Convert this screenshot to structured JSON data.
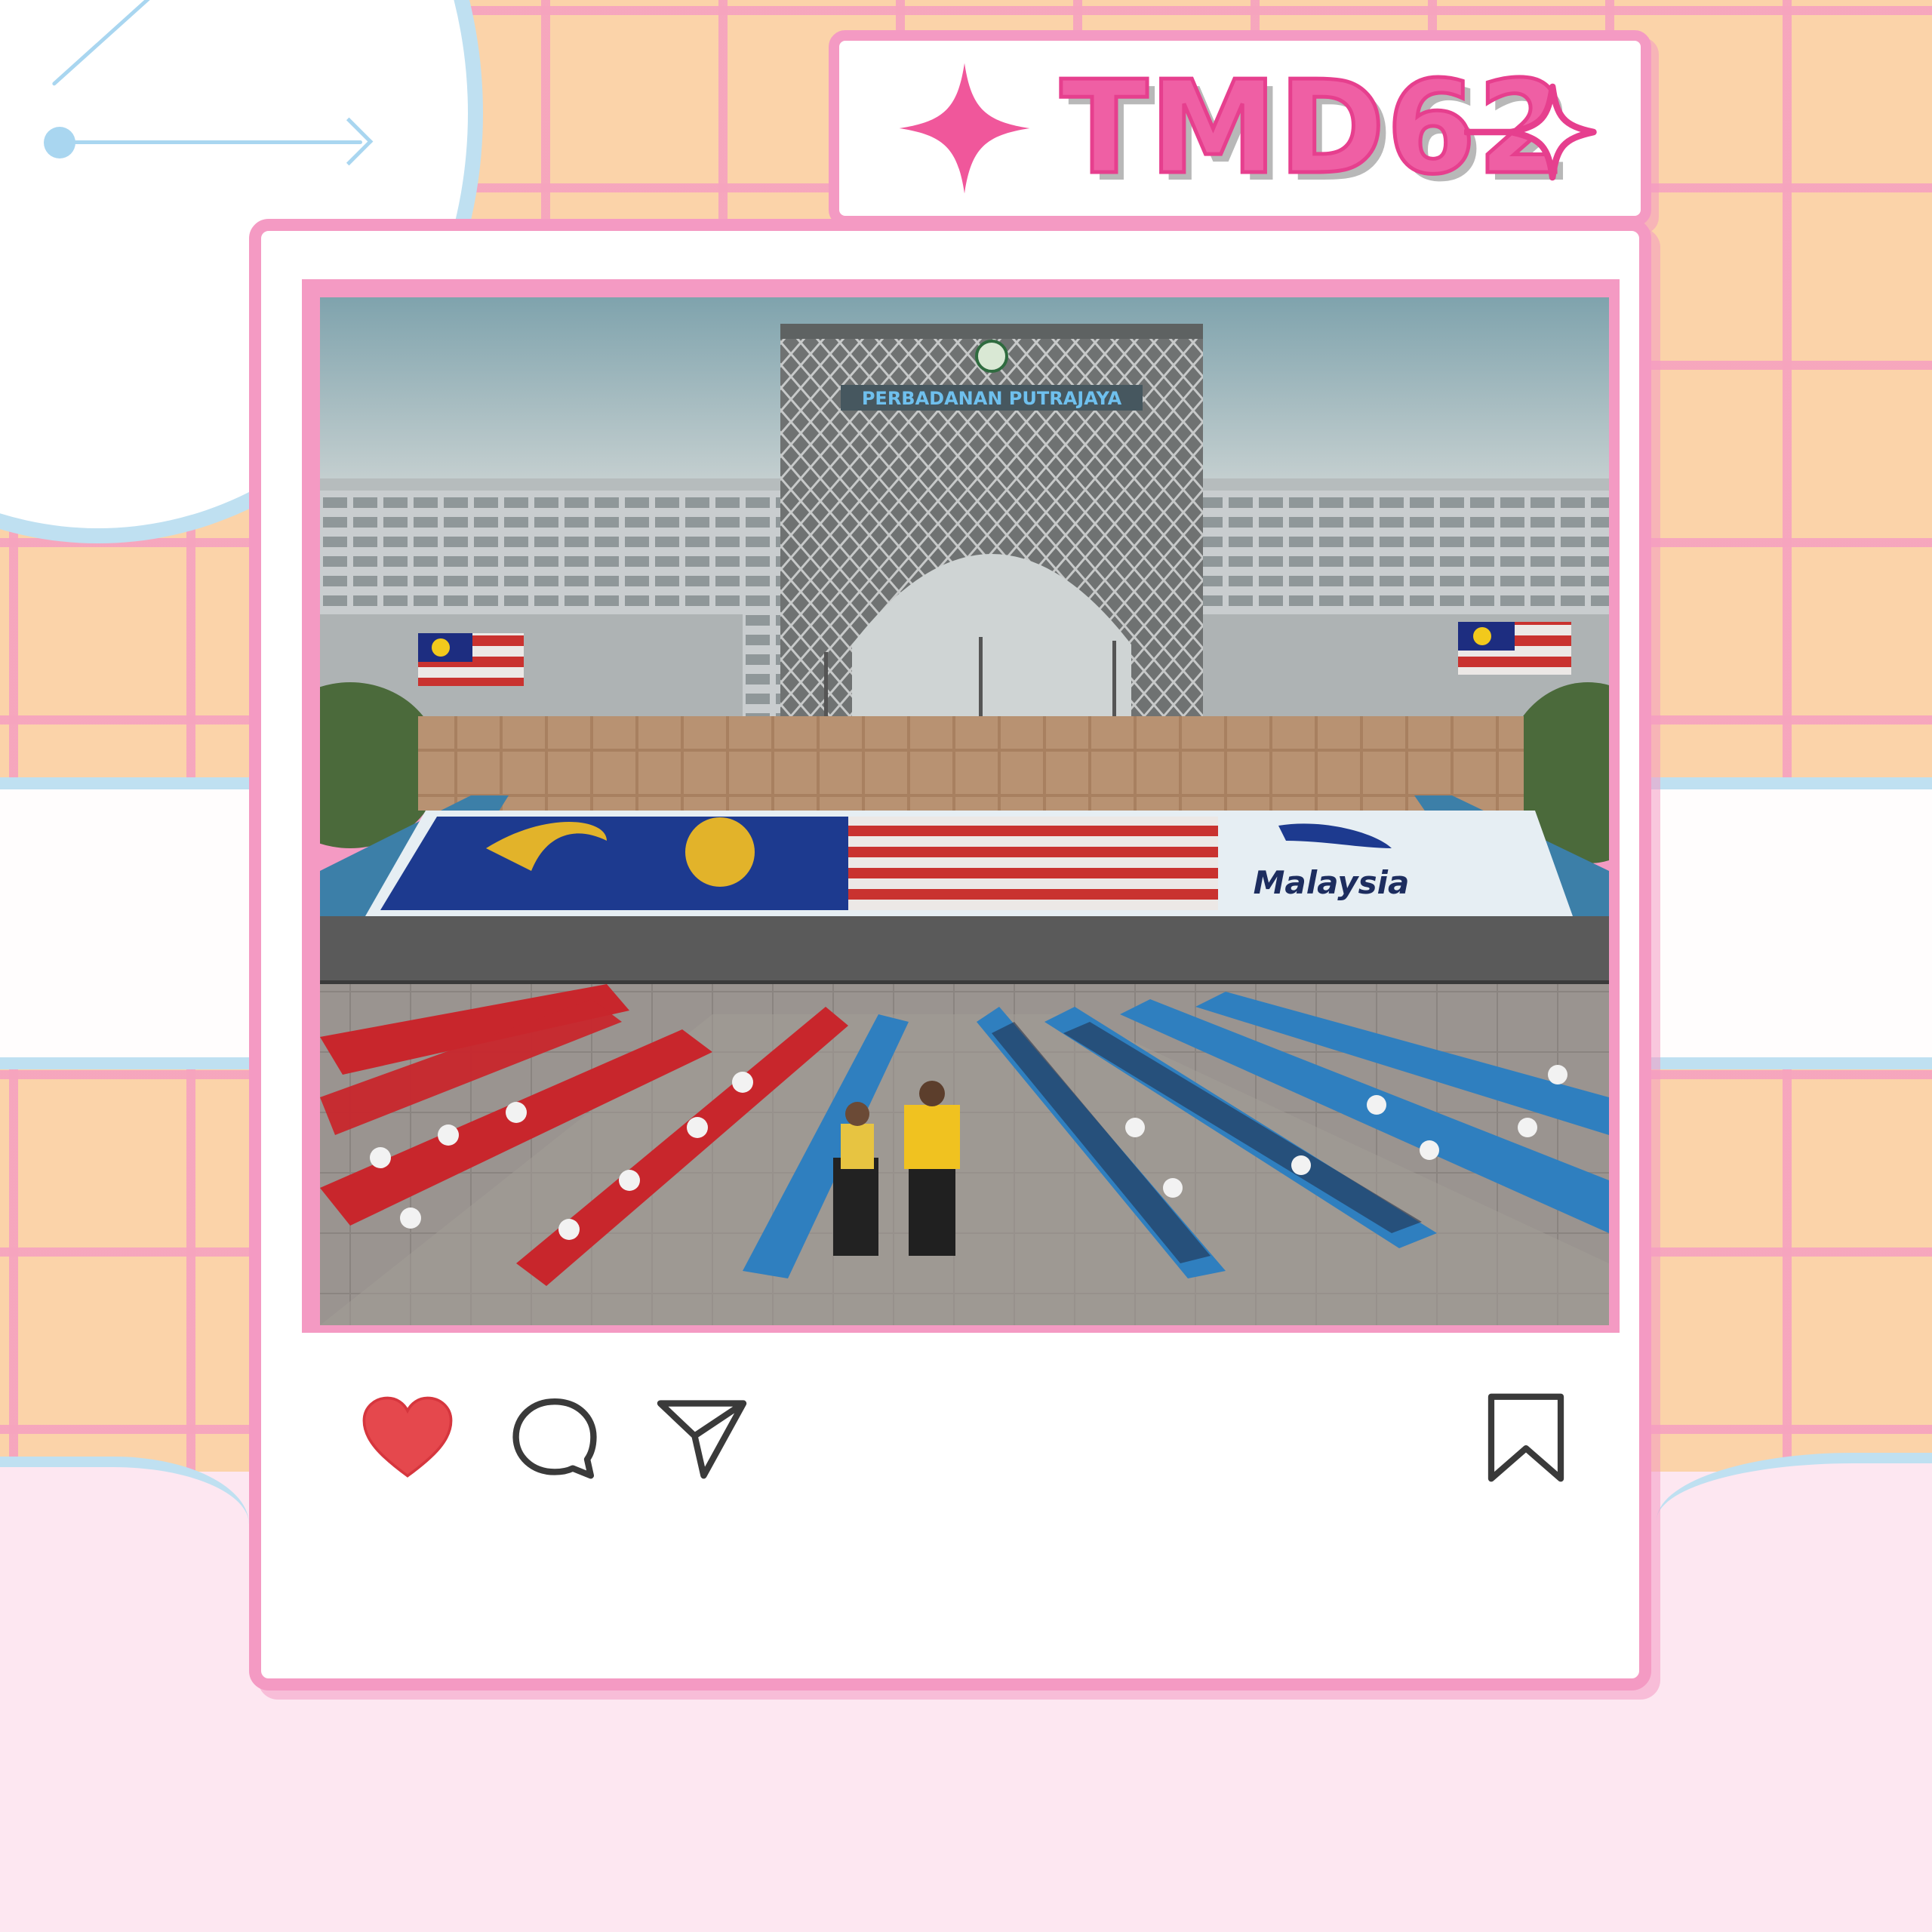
{
  "header": {
    "title": "TMD62",
    "left_icon": "sparkle-solid-icon",
    "right_icon": "sparkle-outline-icon"
  },
  "post": {
    "photo": {
      "building_sign": "PERBADANAN PUTRAJAYA",
      "banner_text": "Malaysia"
    },
    "actions": [
      {
        "name": "like",
        "icon": "heart-icon",
        "state": "liked"
      },
      {
        "name": "comment",
        "icon": "comment-icon"
      },
      {
        "name": "share",
        "icon": "send-icon"
      },
      {
        "name": "save",
        "icon": "bookmark-icon"
      }
    ]
  },
  "colors": {
    "frame_pink": "#f49ac3",
    "title_pink": "#ef5fa4",
    "heart_red": "#e5484d",
    "grid_peach": "#fbd3a9",
    "accent_blue": "#bfe0f1"
  }
}
